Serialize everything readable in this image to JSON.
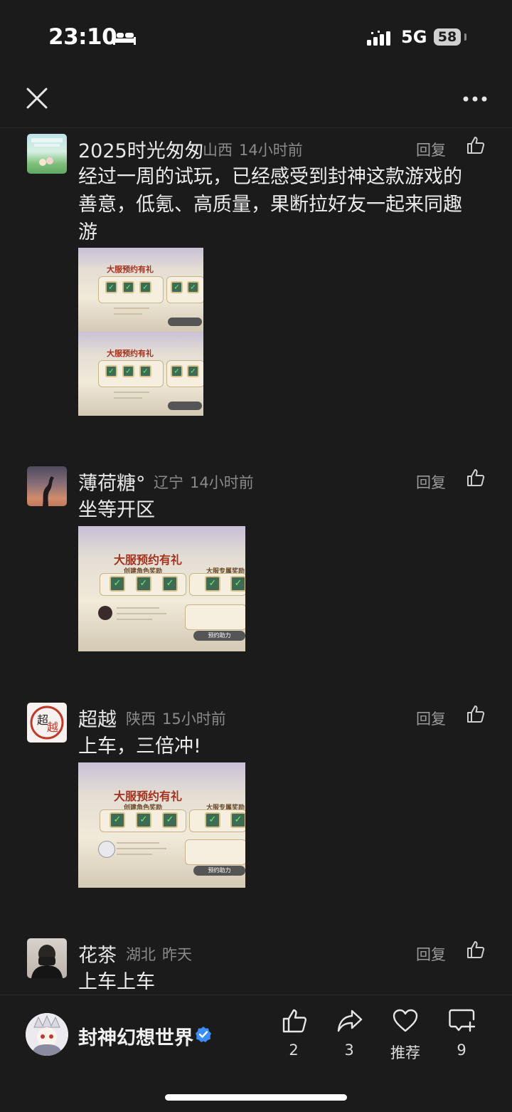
{
  "status_bar": {
    "time": "23:10",
    "network": "5G",
    "battery": "58"
  },
  "comments": [
    {
      "username": "2025时光匆匆",
      "location": "山西",
      "time": "14小时前",
      "reply_label": "回复",
      "text": "经过一周的试玩，已经感受到封神这款游戏的善意，低氪、高质量，果断拉好友一起来同趣游"
    },
    {
      "username": "薄荷糖°",
      "location": "辽宁",
      "time": "14小时前",
      "reply_label": "回复",
      "text": "坐等开区"
    },
    {
      "username": "超越",
      "location": "陕西",
      "time": "15小时前",
      "reply_label": "回复",
      "text": "上车，三倍冲!"
    },
    {
      "username": "花茶",
      "location": "湖北",
      "time": "昨天",
      "reply_label": "回复",
      "text": "上车上车"
    }
  ],
  "embedded_image": {
    "title": "大服预约有礼",
    "create_reward": "创建角色奖励",
    "server_reward": "大服专属奖励",
    "reserve_button": "预约助力"
  },
  "bottom_bar": {
    "game_name": "封神幻想世界",
    "actions": [
      {
        "icon": "thumbs-up-icon",
        "label": "2"
      },
      {
        "icon": "share-icon",
        "label": "3"
      },
      {
        "icon": "heart-icon",
        "label": "推荐"
      },
      {
        "icon": "comment-add-icon",
        "label": "9"
      }
    ]
  },
  "colors": {
    "background": "#1b1b1b",
    "verified": "#3a8ef6"
  }
}
